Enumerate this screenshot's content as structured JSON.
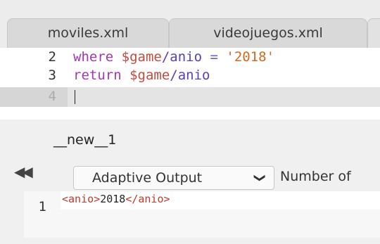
{
  "tabs": [
    {
      "label": "moviles.xml"
    },
    {
      "label": "videojuegos.xml"
    },
    {
      "label": ""
    }
  ],
  "editor": {
    "lines": [
      {
        "number": "2",
        "kw": "where",
        "var": "$game",
        "path": "/anio",
        "op": " = ",
        "str": "'2018'"
      },
      {
        "number": "3",
        "kw": "return",
        "var": "$game",
        "path": "/anio"
      },
      {
        "number": "4"
      }
    ]
  },
  "result_tab": {
    "label": "__new__1"
  },
  "toolbar": {
    "collapse_icon": "double-chevron-left-icon",
    "output_mode": "Adaptive Output",
    "number_label": "Number of"
  },
  "output": {
    "line_number": "1",
    "open_tag": "<anio>",
    "value": "2018",
    "close_tag": "</anio>"
  }
}
